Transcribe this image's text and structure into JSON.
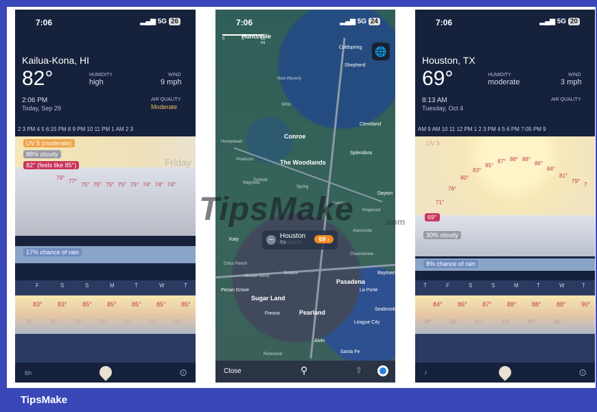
{
  "left": {
    "time": "7:06",
    "network": "5G",
    "battery": "26",
    "city": "Kailua-Kona, HI",
    "temp": "82°",
    "humidity_label": "HUMIDITY",
    "humidity": "high",
    "wind_label": "WIND",
    "wind": "9 mph",
    "updated": "2:06 PM",
    "date": "Today, Sep 29",
    "aq_label": "AIR QUALITY",
    "aq": "Moderate",
    "hours": "2   3 PM   4   5   6:15 PM   8   9 PM  10  11 PM   1 AM   2   3",
    "day_label": "Friday",
    "uv": "UV 5 (moderate)",
    "cloudy": "88% cloudy",
    "feels": "82° (feels like 85°)",
    "hourly_temps": [
      "79°",
      "77°",
      "75°",
      "75°",
      "75°",
      "75°",
      "75°",
      "74°",
      "74°",
      "74°"
    ],
    "rain": "17% chance of rain",
    "days": [
      "F",
      "S",
      "S",
      "M",
      "T",
      "W",
      "T"
    ],
    "highs": [
      "83°",
      "83°",
      "85°",
      "85°",
      "85°",
      "85°",
      "85°"
    ],
    "lows": [
      "76°",
      "75°",
      "75°",
      "75°",
      "75°",
      "75°",
      "75°"
    ],
    "range": "6h"
  },
  "middle": {
    "time": "7:06",
    "network": "5G",
    "battery": "24",
    "scale": [
      "0",
      "5",
      "10 mi"
    ],
    "places": [
      "Huntsville",
      "Coldspring",
      "Shepherd",
      "Conroe",
      "The Woodlands",
      "Cleveland",
      "Splendora",
      "Dayton",
      "Katy",
      "Houston",
      "Sugar Land",
      "Pasadena",
      "Baytown",
      "Pearland",
      "La Porte",
      "Seabrook",
      "League City",
      "Fresno",
      "Alvin",
      "Santa Fe",
      "Pecan Grove",
      "Richmond",
      "Cinco Ranch",
      "Mission Bend",
      "Bellaire",
      "Channelview",
      "Willis",
      "New Waverly",
      "Magnolia",
      "Tomball",
      "Hempstead",
      "Pinehurst",
      "Spring",
      "Humble",
      "Kingwood",
      "Atascocita"
    ],
    "callout_city": "Houston",
    "callout_state": "TX",
    "callout_temp": "69",
    "close": "Close"
  },
  "right": {
    "time": "7:06",
    "network": "5G",
    "battery": "20",
    "city": "Houston, TX",
    "temp": "69°",
    "humidity_label": "HUMIDITY",
    "humidity": "moderate",
    "wind_label": "WIND",
    "wind": "3 mph",
    "updated": "8:13 AM",
    "date": "Tuesday, Oct 4",
    "aq_label": "AIR QUALITY",
    "aq": "",
    "hours": "AM  9 AM  10  11 12 PM  1   2   3 PM   4   5   6 PM  7:05 PM  9",
    "uv": "UV 5",
    "now_temp": "69°",
    "hourly_temps": [
      "71°",
      "76°",
      "80°",
      "83°",
      "85°",
      "87°",
      "88°",
      "88°",
      "86°",
      "84°",
      "81°",
      "79°",
      "7"
    ],
    "cloudy": "30% cloudy",
    "rain": "8% chance of rain",
    "days": [
      "T",
      "F",
      "S",
      "S",
      "M",
      "T",
      "W",
      "T"
    ],
    "highs": [
      "84°",
      "86°",
      "87°",
      "88°",
      "88°",
      "88°",
      "90°"
    ],
    "lows": [
      "58°",
      "59°",
      "61°",
      "63°",
      "66°",
      "66°"
    ],
    "range": "/"
  },
  "watermark": "TipsMake",
  "watermark_domain": ".com",
  "footer": "TipsMake"
}
